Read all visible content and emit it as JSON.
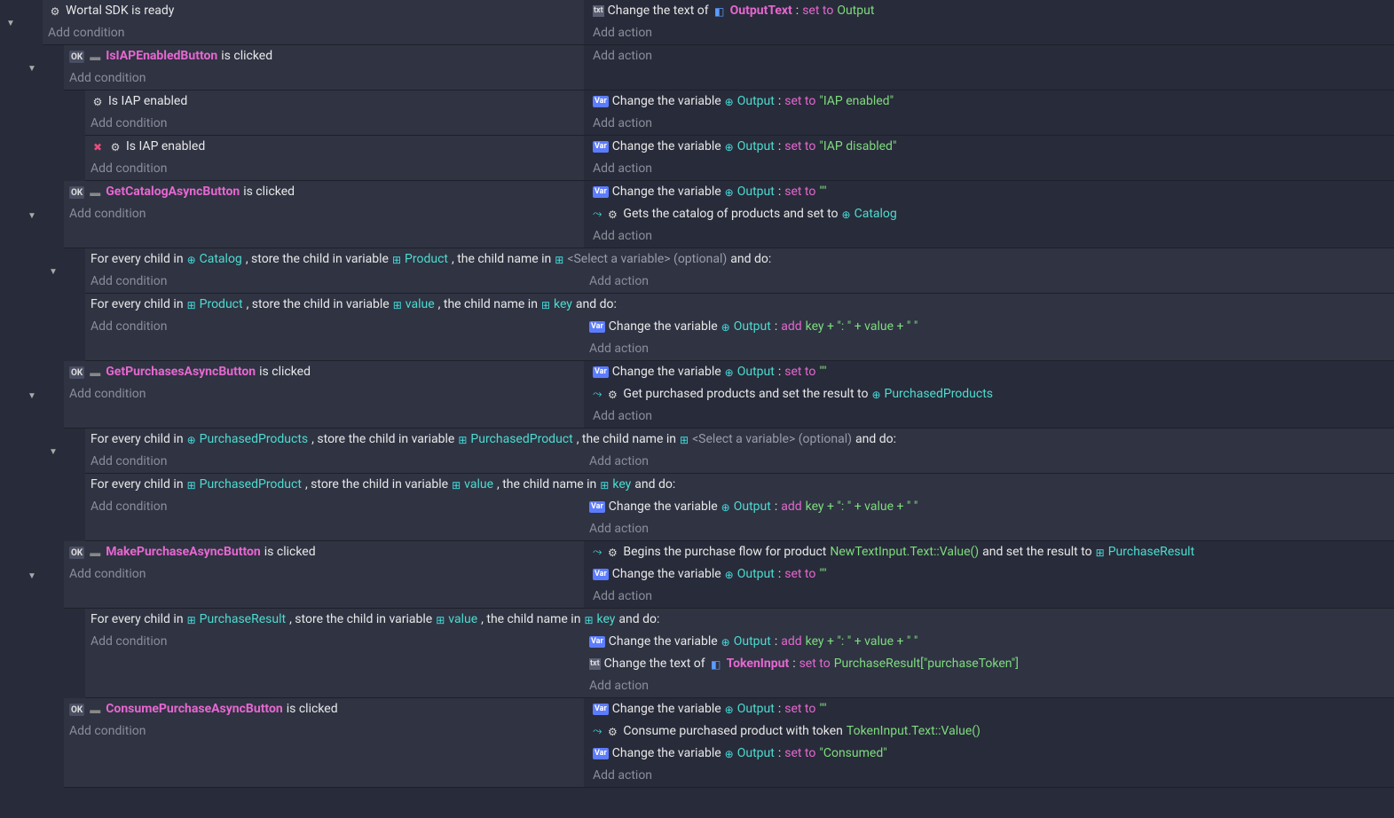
{
  "addCondition": "Add condition",
  "addAction": "Add action",
  "isClicked": "is clicked",
  "setTo": "set to",
  "add": "add",
  "changeText": "Change the text of",
  "changeVar": "Change the variable",
  "e0": {
    "cond": "Wortal SDK is ready",
    "obj": "OutputText",
    "val": "Output"
  },
  "e1": {
    "btn": "IsIAPEnabledButton"
  },
  "e1a": {
    "cond": "Is IAP enabled",
    "val": "\"IAP enabled\""
  },
  "e1b": {
    "cond": "Is IAP enabled",
    "val": "\"IAP disabled\""
  },
  "output": "Output",
  "e2": {
    "btn": "GetCatalogAsyncButton",
    "txt": "Gets the catalog of products and set to",
    "var": "Catalog"
  },
  "e2a": {
    "p1": "For every child in",
    "v1": "Catalog",
    "p2": ", store the child in variable",
    "v2": "Product",
    "p3": ", the child name in",
    "v3": "<Select a variable> (optional)",
    "p4": "and do:"
  },
  "e2b": {
    "p1": "For every child in",
    "v1": "Product",
    "p2": ", store the child in variable",
    "v2": "value",
    "p3": ", the child name in",
    "v3": "key",
    "p4": "and do:",
    "expr": "key + \": \" + value + \" \""
  },
  "e3": {
    "btn": "GetPurchasesAsyncButton",
    "txt": "Get purchased products and set the result to",
    "var": "PurchasedProducts"
  },
  "e3a": {
    "v1": "PurchasedProducts",
    "v2": "PurchasedProduct",
    "v3": "<Select a variable> (optional)"
  },
  "e3b": {
    "v1": "PurchasedProduct",
    "v2": "value",
    "v3": "key",
    "expr": "key + \": \" + value + \" \""
  },
  "e4": {
    "btn": "MakePurchaseAsyncButton",
    "txt": "Begins the purchase flow for product",
    "val": "NewTextInput.Text::Value()",
    "txt2": "and set the result to",
    "var": "PurchaseResult"
  },
  "e4a": {
    "v1": "PurchaseResult",
    "v2": "value",
    "v3": "key",
    "expr": "key + \": \" + value + \" \"",
    "obj": "TokenInput",
    "tokval": "PurchaseResult[\"purchaseToken\"]"
  },
  "e5": {
    "btn": "ConsumePurchaseAsyncButton",
    "txt": "Consume purchased product with token",
    "val": "TokenInput.Text::Value()",
    "val2": "\"Consumed\""
  },
  "empty": "\"\""
}
